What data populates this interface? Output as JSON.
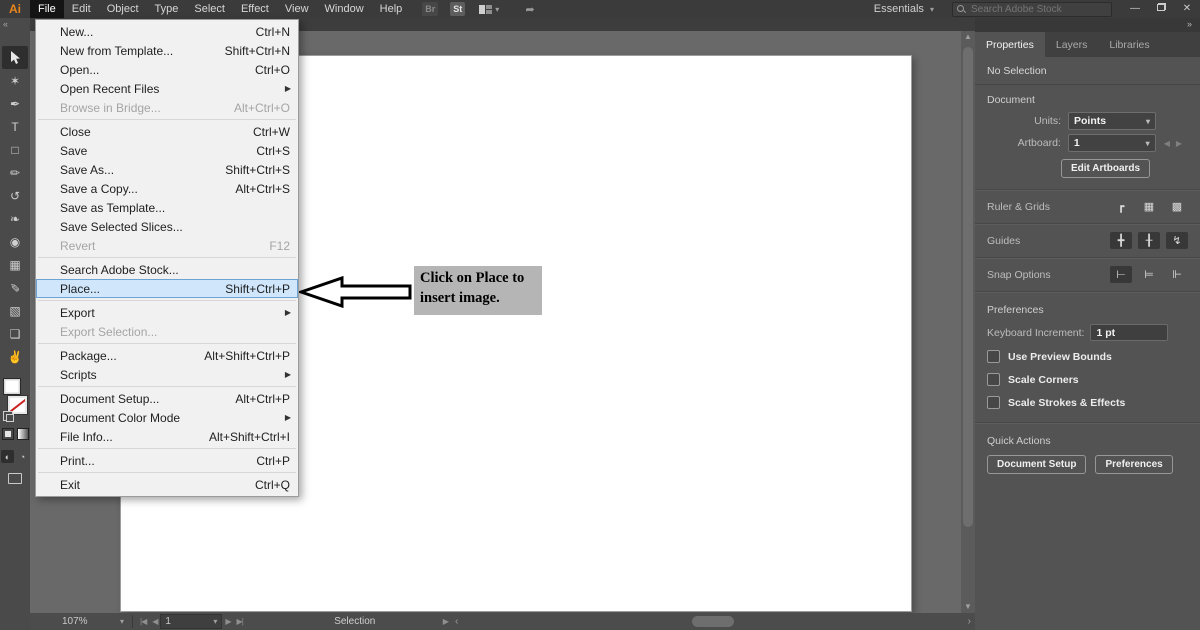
{
  "menubar": {
    "logo": "Ai",
    "items": [
      "File",
      "Edit",
      "Object",
      "Type",
      "Select",
      "Effect",
      "View",
      "Window",
      "Help"
    ],
    "active_item": "File",
    "bridge_icon_label": "Br",
    "stock_icon_label": "St",
    "workspace_label": "Essentials",
    "search_placeholder": "Search Adobe Stock",
    "window_controls": {
      "minimize": "—",
      "close": "✕"
    }
  },
  "file_menu": {
    "items": [
      {
        "label": "New...",
        "shortcut": "Ctrl+N"
      },
      {
        "label": "New from Template...",
        "shortcut": "Shift+Ctrl+N"
      },
      {
        "label": "Open...",
        "shortcut": "Ctrl+O"
      },
      {
        "label": "Open Recent Files",
        "submenu": true
      },
      {
        "label": "Browse in Bridge...",
        "shortcut": "Alt+Ctrl+O",
        "disabled": true
      },
      {
        "separator": true
      },
      {
        "label": "Close",
        "shortcut": "Ctrl+W"
      },
      {
        "label": "Save",
        "shortcut": "Ctrl+S"
      },
      {
        "label": "Save As...",
        "shortcut": "Shift+Ctrl+S"
      },
      {
        "label": "Save a Copy...",
        "shortcut": "Alt+Ctrl+S"
      },
      {
        "label": "Save as Template..."
      },
      {
        "label": "Save Selected Slices..."
      },
      {
        "label": "Revert",
        "shortcut": "F12",
        "disabled": true
      },
      {
        "separator": true
      },
      {
        "label": "Search Adobe Stock..."
      },
      {
        "label": "Place...",
        "shortcut": "Shift+Ctrl+P",
        "highlighted": true
      },
      {
        "separator": true
      },
      {
        "label": "Export",
        "submenu": true
      },
      {
        "label": "Export Selection...",
        "disabled": true
      },
      {
        "separator": true
      },
      {
        "label": "Package...",
        "shortcut": "Alt+Shift+Ctrl+P"
      },
      {
        "label": "Scripts",
        "submenu": true
      },
      {
        "separator": true
      },
      {
        "label": "Document Setup...",
        "shortcut": "Alt+Ctrl+P"
      },
      {
        "label": "Document Color Mode",
        "submenu": true
      },
      {
        "label": "File Info...",
        "shortcut": "Alt+Shift+Ctrl+I"
      },
      {
        "separator": true
      },
      {
        "label": "Print...",
        "shortcut": "Ctrl+P"
      },
      {
        "separator": true
      },
      {
        "label": "Exit",
        "shortcut": "Ctrl+Q"
      }
    ]
  },
  "toolbar": {
    "collapse_icon": "«",
    "tools": [
      {
        "name": "selection-tool",
        "glyph": "svg-arrow",
        "active": true
      },
      {
        "name": "magic-wand-tool",
        "glyph": "✶"
      },
      {
        "name": "pen-tool",
        "glyph": "✒"
      },
      {
        "name": "type-tool",
        "glyph": "T"
      },
      {
        "name": "rectangle-tool",
        "glyph": "□"
      },
      {
        "name": "pencil-tool",
        "glyph": "✏"
      },
      {
        "name": "rotate-tool",
        "glyph": "↺"
      },
      {
        "name": "symbol-flourish-tool",
        "glyph": "❧"
      },
      {
        "name": "shape-builder-tool",
        "glyph": "◉"
      },
      {
        "name": "column-graph-tool",
        "glyph": "▦"
      },
      {
        "name": "eyedropper-tool",
        "glyph": "✎"
      },
      {
        "name": "symbol-sprayer-tool",
        "glyph": "▧"
      },
      {
        "name": "artboard-tool",
        "glyph": "❏"
      },
      {
        "name": "hand-tool",
        "glyph": "✌"
      }
    ]
  },
  "annotation": {
    "line1": "Click on Place to",
    "line2": "insert image."
  },
  "panel": {
    "collapse_icon": "»",
    "tabs": [
      {
        "label": "Properties",
        "active": true
      },
      {
        "label": "Layers",
        "active": false
      },
      {
        "label": "Libraries",
        "active": false
      }
    ],
    "no_selection": "No Selection",
    "document": {
      "title": "Document",
      "units_label": "Units:",
      "units_value": "Points",
      "artboard_label": "Artboard:",
      "artboard_value": "1",
      "edit_artboards_button": "Edit Artboards"
    },
    "ruler_grids": {
      "label": "Ruler & Grids",
      "icons": [
        {
          "name": "corner-ruler-icon",
          "glyph": "┏",
          "boxed": false
        },
        {
          "name": "grid-icon",
          "glyph": "▦",
          "boxed": false
        },
        {
          "name": "transparency-grid-icon",
          "glyph": "▩",
          "boxed": false
        }
      ]
    },
    "guides": {
      "label": "Guides",
      "icons": [
        {
          "name": "show-guides-icon",
          "glyph": "╋",
          "boxed": true
        },
        {
          "name": "lock-guides-icon",
          "glyph": "╂",
          "boxed": true
        },
        {
          "name": "smart-guides-icon",
          "glyph": "↯",
          "boxed": true
        }
      ]
    },
    "snap_options": {
      "label": "Snap Options",
      "icons": [
        {
          "name": "snap-to-point-icon",
          "glyph": "⊢",
          "boxed": true
        },
        {
          "name": "snap-to-grid-icon",
          "glyph": "⊨",
          "boxed": false
        },
        {
          "name": "snap-to-pixel-icon",
          "glyph": "⊩",
          "boxed": false
        }
      ]
    },
    "preferences": {
      "title": "Preferences",
      "keyboard_increment_label": "Keyboard Increment:",
      "keyboard_increment_value": "1 pt",
      "checkboxes": [
        {
          "label": "Use Preview Bounds",
          "checked": false
        },
        {
          "label": "Scale Corners",
          "checked": false
        },
        {
          "label": "Scale Strokes & Effects",
          "checked": false
        }
      ]
    },
    "quick_actions": {
      "title": "Quick Actions",
      "buttons": [
        "Document Setup",
        "Preferences"
      ]
    }
  },
  "statusbar": {
    "zoom_level": "107%",
    "artboard_value": "1",
    "status_text": "Selection"
  },
  "colors": {
    "menubar_bg": "#3b3b3b",
    "panel_bg": "#535353",
    "canvas_bg": "#696969",
    "artboard_bg": "#ffffff",
    "menu_bg": "#f1f1f1",
    "menu_highlight_bg": "#cfe6fb",
    "menu_highlight_border": "#6da2d5",
    "annotation_box_bg": "#b5b5b5",
    "logo_orange": "#e8861c"
  }
}
